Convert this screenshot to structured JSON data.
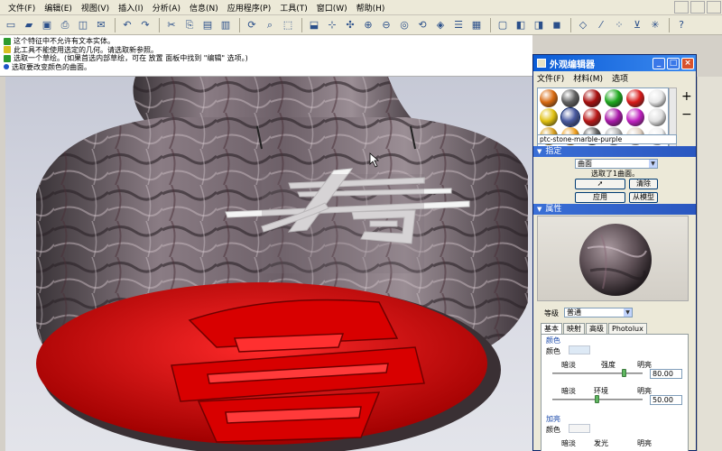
{
  "menu": [
    "文件(F)",
    "编辑(E)",
    "视图(V)",
    "插入(I)",
    "分析(A)",
    "信息(N)",
    "应用程序(P)",
    "工具(T)",
    "窗口(W)",
    "帮助(H)"
  ],
  "messages": [
    {
      "text": "这个特征中不允许有文本实体。",
      "color": "#2e9b2e"
    },
    {
      "text": "此工具不能使用选定的几何。请选取新参照。",
      "color": "#d8c021"
    },
    {
      "text": "选取一个草绘。(如果首选内部草绘，可在 放置 面板中找到 \"编辑\" 选项。)",
      "color": "#2e9b2e"
    },
    {
      "text": "选取要改变颜色的曲面。",
      "color": "#1c55c7"
    }
  ],
  "dialog": {
    "title": "外观编辑器",
    "menu": [
      "文件(F)",
      "材料(M)",
      "选项"
    ],
    "material_name": "ptc-stone-marble-purple",
    "assign_section": "指定",
    "surface_combo": "曲面",
    "selected_text": "选取了1曲面。",
    "clear_button": "清除",
    "apply_button": "应用",
    "from_model_button": "从模型",
    "properties_section": "属性",
    "level_label": "等级",
    "level_value": "普通",
    "tabs": [
      "基本",
      "映射",
      "高级",
      "Photolux"
    ],
    "color_group": "颜色",
    "color_label": "颜色",
    "dim_label": "暗淡",
    "intensity_label": "强度",
    "bright_label": "明亮",
    "intensity_value": "80.00",
    "intensity_level": 0.8,
    "dim2_label": "暗淡",
    "ambient_label": "环境",
    "bright2_label": "明亮",
    "ambient_value": "50.00",
    "ambient_level": 0.5,
    "highlight_group": "加亮",
    "color2_label": "颜色",
    "dim3_label": "暗淡",
    "shine_label": "发光",
    "bright3_label": "明亮",
    "swatch_colors": [
      "#d86a10",
      "#606060",
      "#a81010",
      "#1fa81f",
      "#d81a1a",
      "#e8e8e8",
      "#e0c010",
      "#4a5aa0",
      "#b81818",
      "#a818a8",
      "#c020c0",
      "#e0e0e0",
      "#d8a020",
      "#f0a020",
      "#606060",
      "#b0b0b0",
      "#e0d0c0",
      "#f0f0f0"
    ]
  }
}
